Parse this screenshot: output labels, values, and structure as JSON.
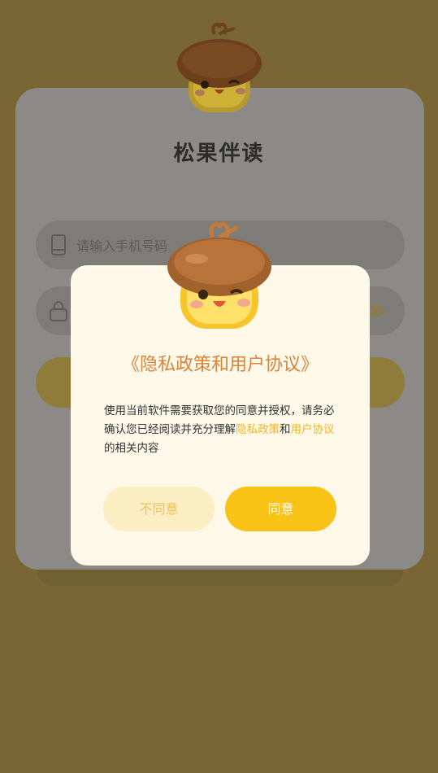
{
  "app": {
    "title": "松果伴读"
  },
  "login": {
    "phone_placeholder": "请输入手机号码"
  },
  "dialog": {
    "title": "《隐私政策和用户协议》",
    "body_text_1": "使用当前软件需要获取您的同意并授权，请务必确认您已经阅读并充分理解",
    "privacy_link": "隐私政策",
    "body_and": "和",
    "user_agreement_link": "用户协议",
    "body_text_2": "的相关内容",
    "disagree_label": "不同意",
    "agree_label": "同意"
  },
  "colors": {
    "accent": "#f9c216",
    "title": "#d9833b",
    "link": "#f4b619",
    "overlay": "#7a6534"
  },
  "icons": [
    "phone-icon",
    "lock-icon",
    "eye-icon",
    "acorn-mascot"
  ]
}
